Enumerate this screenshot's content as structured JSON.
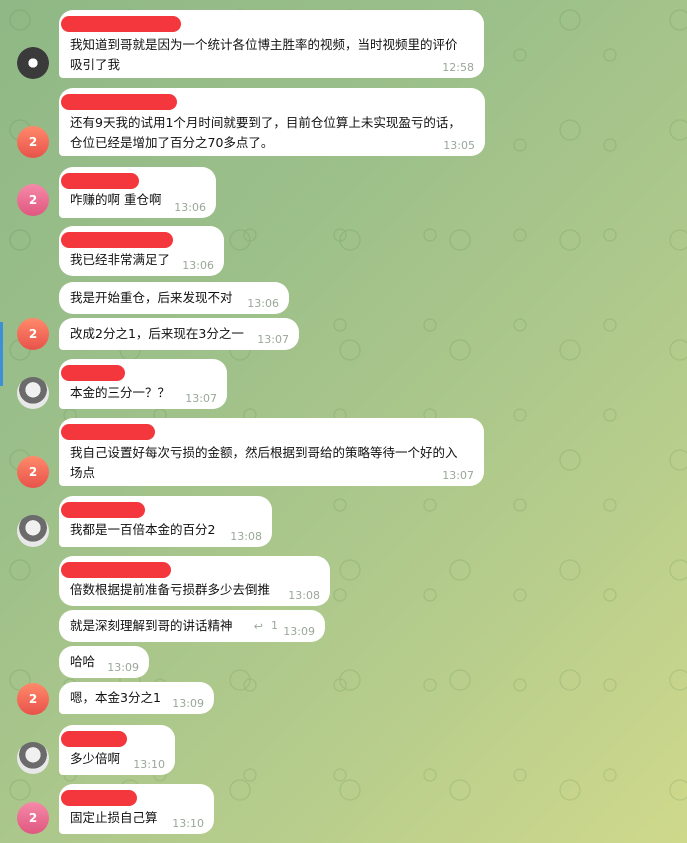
{
  "colors": {
    "redaction": "#f4373d",
    "avatar_red": "#e8524a",
    "avatar_pink": "#e0577f",
    "time": "#9aa79a"
  },
  "messages": [
    {
      "text": "我知道到哥就是因为一个统计各位博主胜率的视频，当时视频里的评价\n吸引了我",
      "time": "12:58",
      "avatar": "hand"
    },
    {
      "text": "还有9天我的试用1个月时间就要到了，目前仓位算上未实现盈亏的话，\n仓位已经是增加了百分之70多点了。",
      "time": "13:05",
      "avatar_label": "2"
    },
    {
      "text": "咋赚的啊 重仓啊",
      "time": "13:06",
      "avatar_label": "2"
    },
    {
      "text": "我已经非常满足了",
      "time": "13:06"
    },
    {
      "text": "我是开始重仓，后来发现不对",
      "time": "13:06"
    },
    {
      "text": "改成2分之1，后来现在3分之一",
      "time": "13:07",
      "avatar_label": "2"
    },
    {
      "text": "本金的三分一？？",
      "time": "13:07",
      "avatar": "photo"
    },
    {
      "text": "我自己设置好每次亏损的金额，然后根据到哥给的策略等待一个好的入\n场点",
      "time": "13:07",
      "avatar_label": "2"
    },
    {
      "text": "我都是一百倍本金的百分2",
      "time": "13:08",
      "avatar": "photo"
    },
    {
      "text": "倍数根据提前准备亏损群多少去倒推",
      "time": "13:08"
    },
    {
      "text": "就是深刻理解到哥的讲话精神",
      "time": "13:09",
      "reply_icon": "reply-arrow-icon",
      "reply_count": "1"
    },
    {
      "text": "哈哈",
      "time": "13:09"
    },
    {
      "text": "嗯，本金3分之1",
      "time": "13:09",
      "avatar_label": "2"
    },
    {
      "text": "多少倍啊",
      "time": "13:10",
      "avatar": "photo"
    },
    {
      "text": "固定止损自己算",
      "time": "13:10",
      "avatar_label": "2"
    }
  ]
}
